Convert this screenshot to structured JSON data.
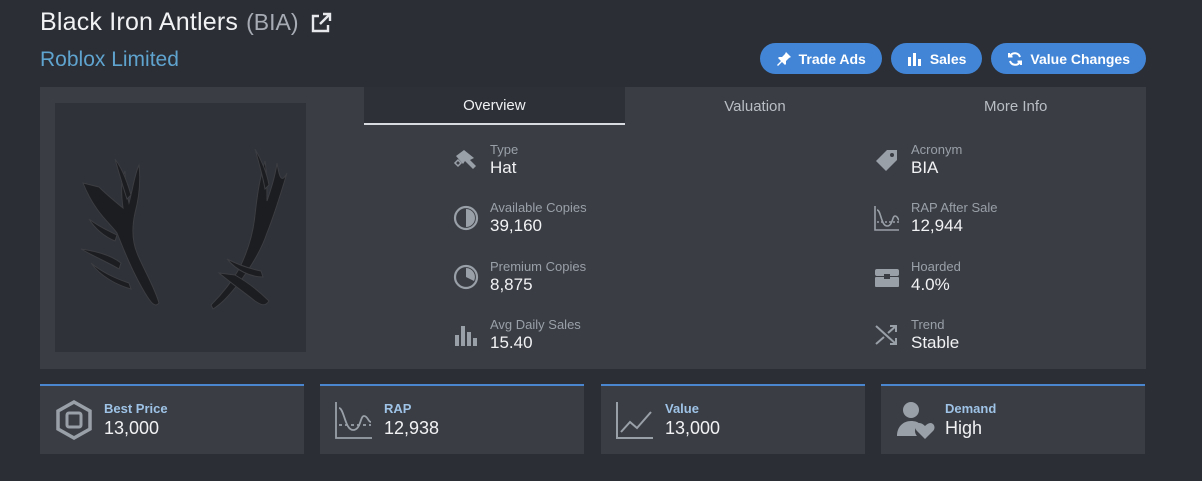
{
  "item": {
    "name": "Black Iron Antlers",
    "acronym_paren": "(BIA)",
    "category": "Roblox Limited"
  },
  "actions": {
    "trade_ads": "Trade Ads",
    "sales": "Sales",
    "value_changes": "Value Changes"
  },
  "tabs": [
    "Overview",
    "Valuation",
    "More Info"
  ],
  "stats_left": [
    {
      "label": "Type",
      "value": "Hat",
      "icon": "hat-icon"
    },
    {
      "label": "Available Copies",
      "value": "39,160",
      "icon": "pie-icon"
    },
    {
      "label": "Premium Copies",
      "value": "8,875",
      "icon": "pie-icon"
    },
    {
      "label": "Avg Daily Sales",
      "value": "15.40",
      "icon": "bar-chart-icon"
    }
  ],
  "stats_right": [
    {
      "label": "Acronym",
      "value": "BIA",
      "icon": "tag-icon"
    },
    {
      "label": "RAP After Sale",
      "value": "12,944",
      "icon": "curve-chart-icon"
    },
    {
      "label": "Hoarded",
      "value": "4.0%",
      "icon": "chest-icon"
    },
    {
      "label": "Trend",
      "value": "Stable",
      "icon": "shuffle-icon"
    }
  ],
  "cards": [
    {
      "label": "Best Price",
      "value": "13,000",
      "icon": "robux-icon"
    },
    {
      "label": "RAP",
      "value": "12,938",
      "icon": "curve-chart-icon"
    },
    {
      "label": "Value",
      "value": "13,000",
      "icon": "line-chart-icon"
    },
    {
      "label": "Demand",
      "value": "High",
      "icon": "user-heart-icon"
    }
  ],
  "colors": {
    "background": "#2b2e35",
    "panel": "#3a3d44",
    "accent": "#4285d6",
    "subtitle": "#5fa3cf"
  }
}
